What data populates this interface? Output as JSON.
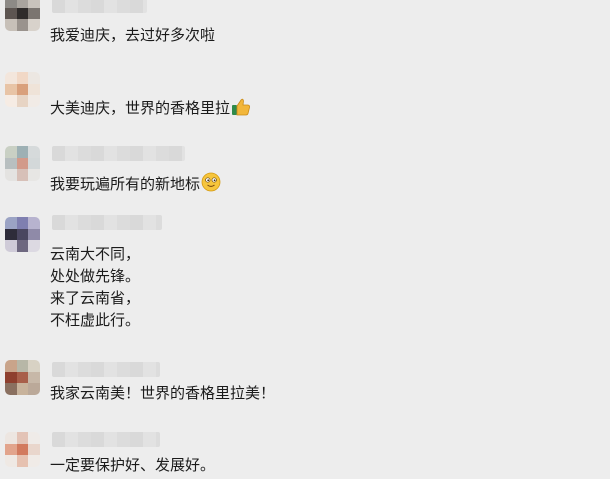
{
  "comments": [
    {
      "lines": [
        "我爱迪庆，去过好多次啦"
      ]
    },
    {
      "lines": [
        "大美迪庆，世界的香格里拉"
      ],
      "emoji": "thumbs-up-icon"
    },
    {
      "lines": [
        "我要玩遍所有的新地标"
      ],
      "emoji": "smiling-face-icon"
    },
    {
      "lines": [
        "云南大不同，",
        "处处做先锋。",
        "来了云南省，",
        "不枉虚此行。"
      ]
    },
    {
      "lines": [
        "我家云南美！世界的香格里拉美！"
      ]
    },
    {
      "lines": [
        "一定要保护好、发展好。"
      ]
    }
  ]
}
